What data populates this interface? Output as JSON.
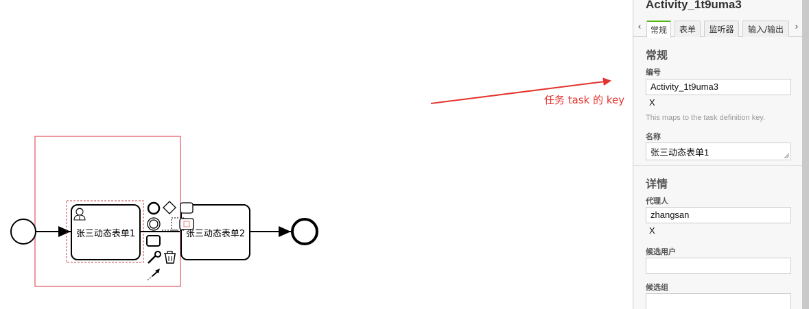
{
  "diagram": {
    "task1_label": "张三动态表单1",
    "task2_label": "张三动态表单2",
    "annotation": "任务 task 的 key",
    "colors": {
      "annotation": "#e2332d",
      "selection": "#d9363e",
      "stroke": "#000000"
    }
  },
  "panel": {
    "header": "Activity_1t9uma3",
    "tabs": [
      "常规",
      "表单",
      "监听器",
      "输入/输出"
    ],
    "active_tab": "常规",
    "section_general": "常规",
    "id_label": "编号",
    "id_value": "Activity_1t9uma3",
    "id_clear": "X",
    "id_help": "This maps to the task definition key.",
    "name_label": "名称",
    "name_value": "张三动态表单1",
    "section_details": "详情",
    "assignee_label": "代理人",
    "assignee_value": "zhangsan",
    "assignee_clear": "X",
    "candidate_users_label": "候选用户",
    "candidate_users_value": "",
    "candidate_groups_label": "候选组",
    "candidate_groups_value": "",
    "colors": {
      "tab_active": "#52b415"
    }
  }
}
